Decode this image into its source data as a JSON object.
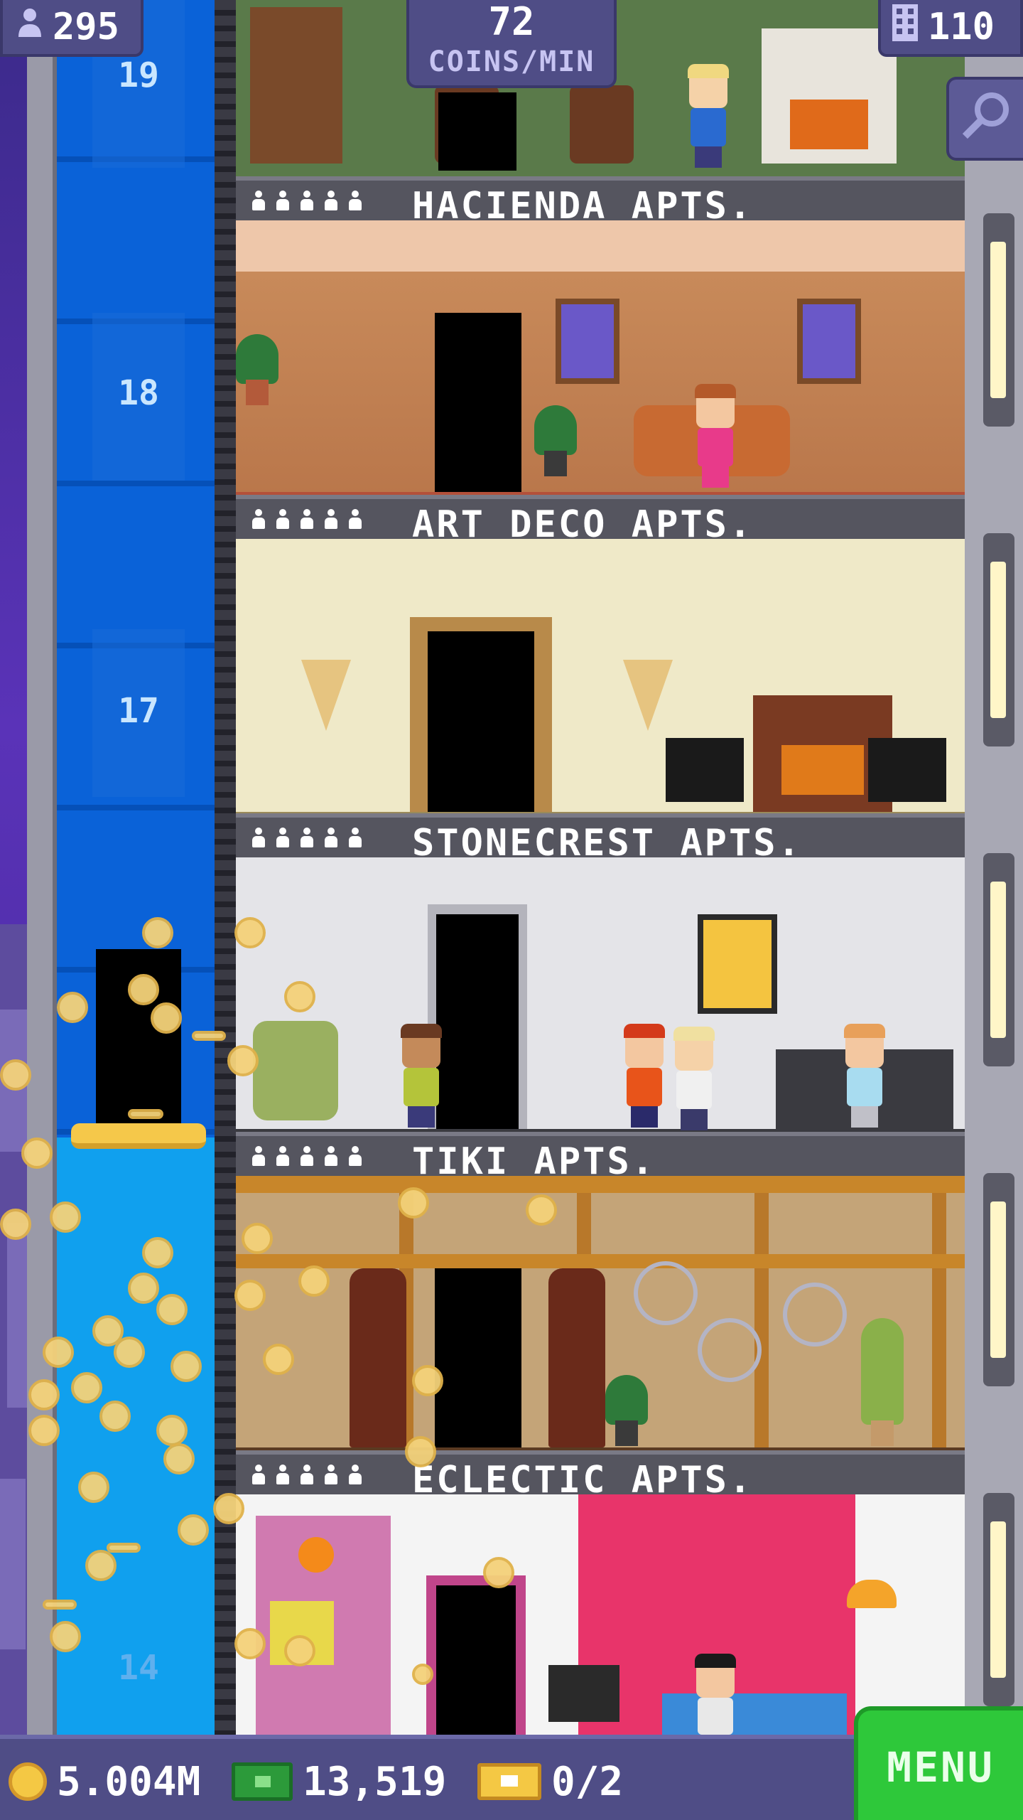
{
  "hud": {
    "population": "295",
    "coins_rate_value": "72",
    "coins_rate_unit": "COINS/MIN",
    "floors_count": "110",
    "population_icon": "person-icon",
    "floors_icon": "building-icon",
    "zoom_icon": "magnifier-icon"
  },
  "elevator": {
    "floor_numbers": [
      "19",
      "18",
      "17",
      "14"
    ]
  },
  "floors": [
    {
      "name": "HACIENDA APTS.",
      "theme": "hacienda"
    },
    {
      "name": "ART DECO APTS.",
      "theme": "art-deco"
    },
    {
      "name": "STONECREST APTS.",
      "theme": "stonecrest"
    },
    {
      "name": "TIKI APTS.",
      "theme": "tiki"
    },
    {
      "name": "ECLECTIC APTS.",
      "theme": "eclectic"
    }
  ],
  "bottom": {
    "coins": "5.004M",
    "bux": "13,519",
    "tickets": "0/2",
    "menu_label": "MENU"
  },
  "colors": {
    "hud_bg": "#4f4d86",
    "menu_green": "#2ec83a",
    "elevator_blue": "#0a62d8",
    "coin_gold": "#f4c844"
  }
}
